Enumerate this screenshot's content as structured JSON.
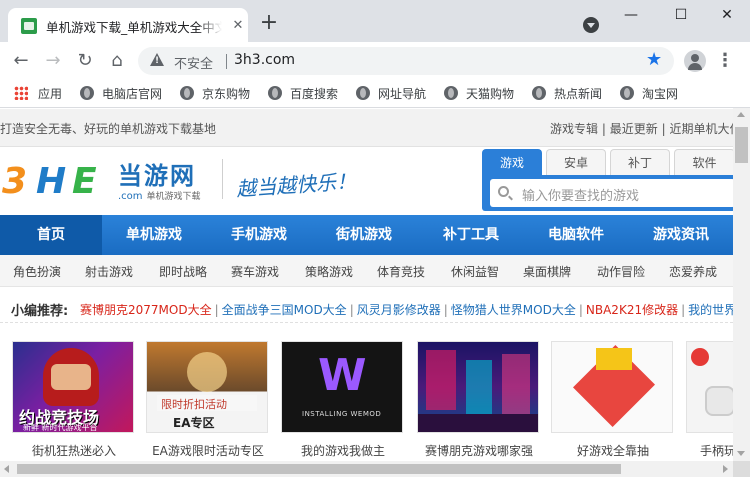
{
  "browser": {
    "tab_title": "单机游戏下载_单机游戏大全中文",
    "tab_close": "✕",
    "new_tab": "+",
    "window_controls": {
      "minimize": "—",
      "maximize": "☐",
      "close": "✕"
    },
    "nav": {
      "back": "←",
      "forward": "→",
      "reload": "↻",
      "home": "⌂"
    },
    "security_label": "不安全",
    "url": "3h3.com",
    "star": "★",
    "menu": "⋮"
  },
  "bookmarks": [
    {
      "label": "应用",
      "icon": "apps-grid-icon"
    },
    {
      "label": "电脑店官网",
      "icon": "globe-icon"
    },
    {
      "label": "京东购物",
      "icon": "globe-icon"
    },
    {
      "label": "百度搜索",
      "icon": "globe-icon"
    },
    {
      "label": "网址导航",
      "icon": "globe-icon"
    },
    {
      "label": "天猫购物",
      "icon": "globe-icon"
    },
    {
      "label": "热点新闻",
      "icon": "globe-icon"
    },
    {
      "label": "淘宝网",
      "icon": "globe-icon"
    }
  ],
  "site": {
    "tagline": "打造安全无毒、好玩的单机游戏下载基地",
    "top_links": [
      "游戏专辑",
      "最近更新",
      "近期单机大作"
    ],
    "top_link_sep": "|",
    "logo": {
      "part1": "3",
      "part2": "H",
      "part3": "E"
    },
    "brand": "当游网",
    "domain": ".com",
    "brand_sub": "单机游戏下载",
    "slogan": "越当越快乐！",
    "search_tabs": [
      "游戏",
      "安卓",
      "补丁",
      "软件"
    ],
    "search_placeholder": "输入你要查找的游戏",
    "main_nav": [
      "首页",
      "单机游戏",
      "手机游戏",
      "街机游戏",
      "补丁工具",
      "电脑软件",
      "游戏资讯"
    ],
    "sub_nav": [
      "角色扮演",
      "射击游戏",
      "即时战略",
      "赛车游戏",
      "策略游戏",
      "体育竞技",
      "休闲益智",
      "桌面棋牌",
      "动作冒险",
      "恋爱养成"
    ],
    "recommend_label": "小编推荐:",
    "recommend_items": [
      {
        "text": "赛博朋克2077MOD大全",
        "highlight": true
      },
      {
        "text": "全面战争三国MOD大全",
        "highlight": false
      },
      {
        "text": "风灵月影修改器",
        "highlight": false
      },
      {
        "text": "怪物猎人世界MOD大全",
        "highlight": false
      },
      {
        "text": "NBA2K21修改器",
        "highlight": true
      },
      {
        "text": "我的世界",
        "highlight": false
      }
    ],
    "cards": [
      {
        "caption": "街机狂热迷必入",
        "thumb_text": "约战竞技场",
        "thumb_sub": "新鲜 新时代游戏平台"
      },
      {
        "caption": "EA游戏限时活动专区",
        "thumb_text": "限时折扣活动",
        "thumb_sub": "EA专区"
      },
      {
        "caption": "我的游戏我做主",
        "thumb_text": "W",
        "thumb_sub": "INSTALLING WEMOD"
      },
      {
        "caption": "赛博朋克游戏哪家强",
        "thumb_text": "",
        "thumb_sub": ""
      },
      {
        "caption": "好游戏全靠抽",
        "thumb_text": "",
        "thumb_sub": ""
      },
      {
        "caption": "手柄玩",
        "thumb_text": "",
        "thumb_sub": ""
      }
    ]
  },
  "colors": {
    "brand_blue": "#1f6fb8",
    "nav_blue": "#2b82d9",
    "highlight_red": "#d8261a",
    "logo_orange": "#f38f1c",
    "logo_green": "#37b34a"
  }
}
